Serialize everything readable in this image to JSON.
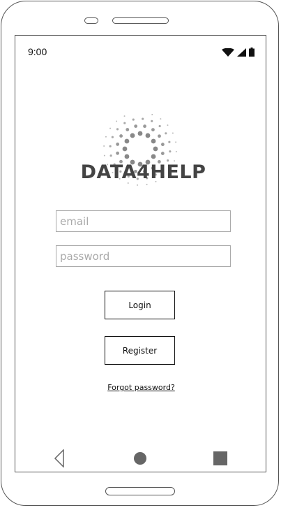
{
  "status": {
    "time": "9:00",
    "icons": [
      "wifi-icon",
      "signal-icon",
      "battery-icon"
    ]
  },
  "logo": {
    "text": "DATA4HELP"
  },
  "form": {
    "email_placeholder": "email",
    "password_placeholder": "password",
    "login_label": "Login",
    "register_label": "Register",
    "forgot_label": "Forgot password?"
  },
  "nav": {
    "icons": [
      "back-icon",
      "home-icon",
      "recent-apps-icon"
    ]
  },
  "colors": {
    "frame": "#555555",
    "logo_dots": "#888888",
    "logo_text": "#444444"
  }
}
